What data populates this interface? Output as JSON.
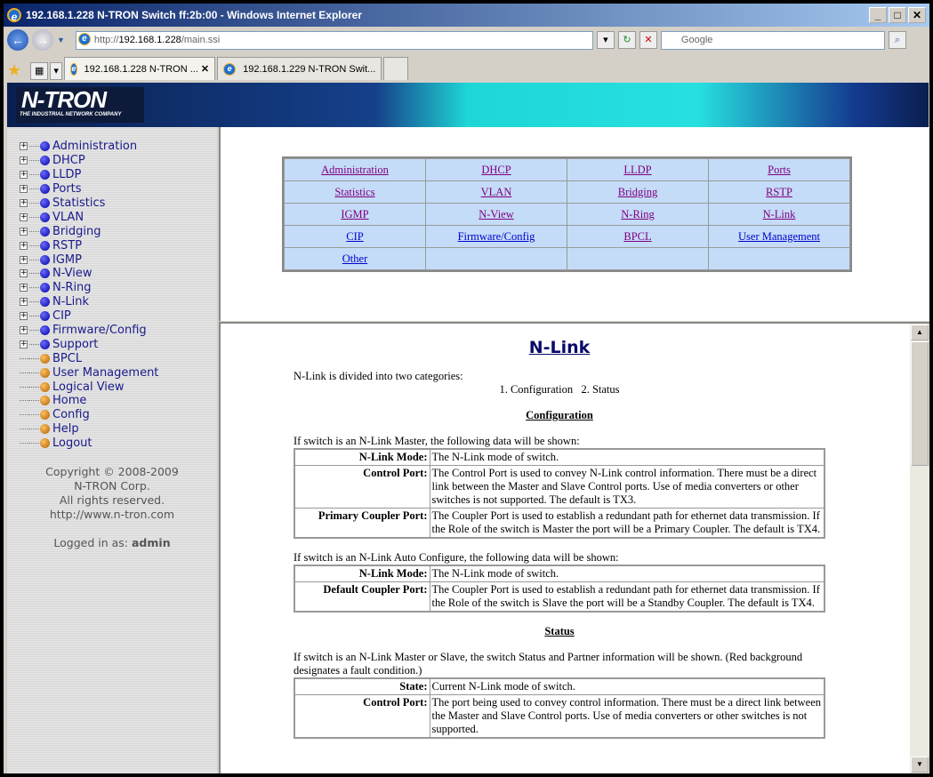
{
  "window": {
    "title": "192.168.1.228 N-TRON Switch ff:2b:00 - Windows Internet Explorer",
    "min": "_",
    "max": "□",
    "close": "✕"
  },
  "browser": {
    "back": "←",
    "forward": "→",
    "url_prefix": "http://",
    "url_host": "192.168.1.228",
    "url_path": "/main.ssi",
    "search_placeholder": "Google",
    "refresh": "↻",
    "stop": "✕",
    "search_btn": "⌕",
    "tabs": [
      {
        "label": "192.168.1.228 N-TRON ...",
        "close": "✕"
      },
      {
        "label": "192.168.1.229 N-TRON Swit..."
      }
    ]
  },
  "banner": {
    "logo": "N-TRON",
    "tagline": "THE INDUSTRIAL NETWORK COMPANY"
  },
  "sidebar": {
    "items": [
      {
        "label": "Administration",
        "exp": true
      },
      {
        "label": "DHCP",
        "exp": true
      },
      {
        "label": "LLDP",
        "exp": true
      },
      {
        "label": "Ports",
        "exp": true
      },
      {
        "label": "Statistics",
        "exp": true
      },
      {
        "label": "VLAN",
        "exp": true
      },
      {
        "label": "Bridging",
        "exp": true
      },
      {
        "label": "RSTP",
        "exp": true
      },
      {
        "label": "IGMP",
        "exp": true
      },
      {
        "label": "N-View",
        "exp": true
      },
      {
        "label": "N-Ring",
        "exp": true
      },
      {
        "label": "N-Link",
        "exp": true
      },
      {
        "label": "CIP",
        "exp": true
      },
      {
        "label": "Firmware/Config",
        "exp": true
      },
      {
        "label": "Support",
        "exp": true
      },
      {
        "label": "BPCL",
        "exp": false
      },
      {
        "label": "User Management",
        "exp": false
      },
      {
        "label": "Logical View",
        "exp": false
      },
      {
        "label": "Home",
        "exp": false
      },
      {
        "label": "Config",
        "exp": false
      },
      {
        "label": "Help",
        "exp": false
      },
      {
        "label": "Logout",
        "exp": false
      }
    ],
    "copyright": "Copyright © 2008-2009",
    "corp": "N-TRON Corp.",
    "rights": "All rights reserved.",
    "website": "http://www.n-tron.com",
    "logged_in_label": "Logged in as:",
    "user": "admin"
  },
  "navtable": [
    [
      "Administration",
      "DHCP",
      "LLDP",
      "Ports"
    ],
    [
      "Statistics",
      "VLAN",
      "Bridging",
      "RSTP"
    ],
    [
      "IGMP",
      "N-View",
      "N-Ring",
      "N-Link"
    ],
    [
      "CIP",
      "Firmware/Config",
      "BPCL",
      "User Management"
    ],
    [
      "Other",
      "",
      "",
      ""
    ]
  ],
  "help": {
    "title": "N-Link",
    "intro": "N-Link is divided into two categories:",
    "categories": "1. Configuration   2. Status",
    "config_heading": "Configuration",
    "master_intro": "If switch is an N-Link Master, the following data will be shown:",
    "master_rows": [
      {
        "k": "N-Link Mode:",
        "v": "The N-Link mode of switch."
      },
      {
        "k": "Control Port:",
        "v": "The Control Port is used to convey N-Link control information. There must be a direct link between the Master and Slave Control ports. Use of media converters or other switches is not supported. The default is TX3."
      },
      {
        "k": "Primary Coupler Port:",
        "v": "The Coupler Port is used to establish a redundant path for ethernet data transmission. If the Role of the switch is Master the port will be a Primary Coupler. The default is TX4."
      }
    ],
    "auto_intro": "If switch is an N-Link Auto Configure, the following data will be shown:",
    "auto_rows": [
      {
        "k": "N-Link Mode:",
        "v": "The N-Link mode of switch."
      },
      {
        "k": "Default Coupler Port:",
        "v": "The Coupler Port is used to establish a redundant path for ethernet data transmission. If the Role of the switch is Slave the port will be a Standby Coupler. The default is TX4."
      }
    ],
    "status_heading": "Status",
    "status_intro": "If switch is an N-Link Master or Slave, the switch Status and Partner information will be shown. (Red background designates a fault condition.)",
    "status_rows": [
      {
        "k": "State:",
        "v": "Current N-Link mode of switch."
      },
      {
        "k": "Control Port:",
        "v": "The port being used to convey control information. There must be a direct link between the Master and Slave Control ports. Use of media converters or other switches is not supported."
      }
    ]
  },
  "scroll": {
    "up": "▲",
    "down": "▼"
  }
}
